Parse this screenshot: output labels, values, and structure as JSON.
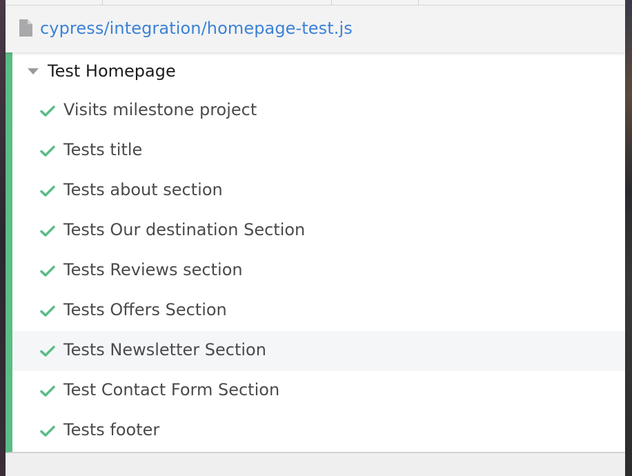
{
  "file": {
    "path": "cypress/integration/homepage-test.js",
    "icon": "file-icon"
  },
  "suite": {
    "title": "Test Homepage",
    "status_color": "#5bbd86",
    "caret_icon": "caret-down-icon"
  },
  "tests": [
    {
      "label": "Visits milestone project",
      "status": "passed"
    },
    {
      "label": "Tests title",
      "status": "passed"
    },
    {
      "label": "Tests about section",
      "status": "passed"
    },
    {
      "label": "Tests Our destination Section",
      "status": "passed"
    },
    {
      "label": "Tests Reviews section",
      "status": "passed"
    },
    {
      "label": "Tests Offers Section",
      "status": "passed"
    },
    {
      "label": "Tests Newsletter Section",
      "status": "passed",
      "hovered": true
    },
    {
      "label": "Test Contact Form Section",
      "status": "passed"
    },
    {
      "label": "Tests footer",
      "status": "passed"
    }
  ],
  "colors": {
    "link": "#3b82d6",
    "pass": "#5bbd86"
  }
}
